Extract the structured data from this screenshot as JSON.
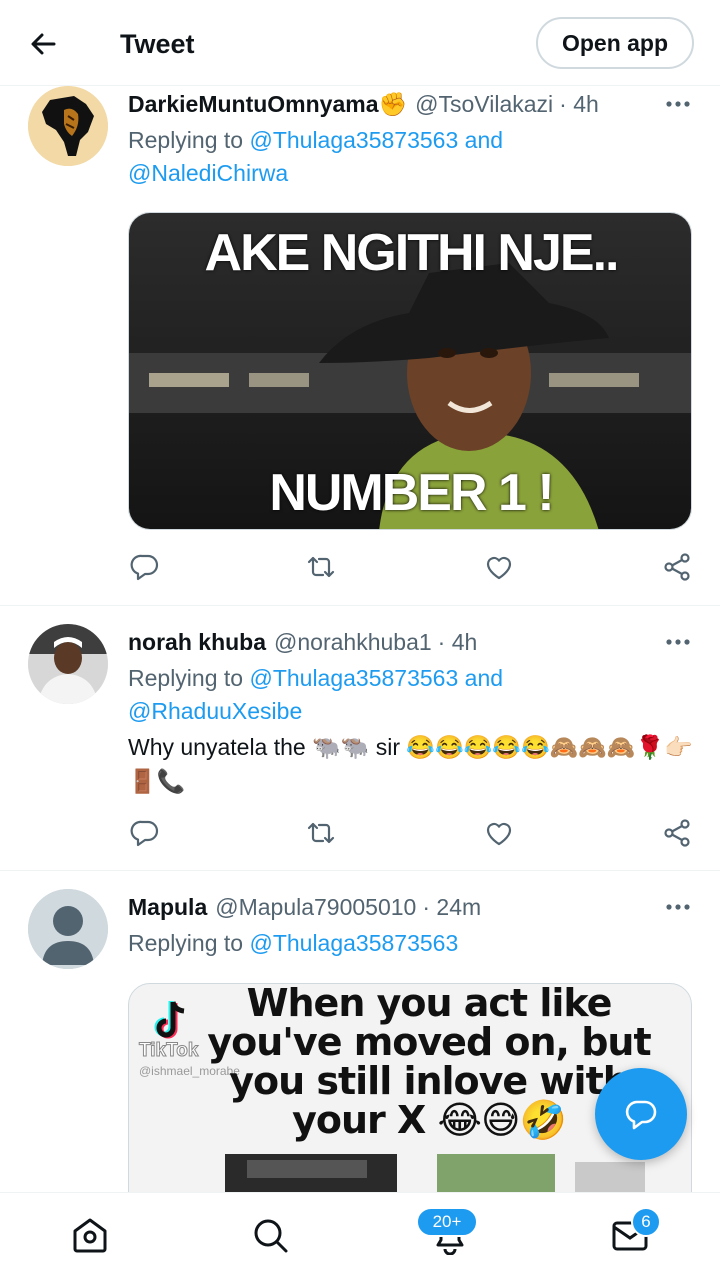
{
  "header": {
    "title": "Tweet",
    "open_app_label": "Open app"
  },
  "tweets": [
    {
      "name": "DarkieMuntuOmnyama",
      "name_emoji": "✊",
      "handle": "@TsoVilakazi",
      "time": "· 4h",
      "replying_prefix": "Replying to",
      "mention_1": "@Thulaga35873563",
      "conjunction": "and",
      "mention_2": "@NalediChirwa",
      "media": {
        "top_text": "AKE NGITHI NJE..",
        "bottom_text": "NUMBER 1 !"
      }
    },
    {
      "name": "norah khuba",
      "handle": "@norahkhuba1",
      "time": "· 4h",
      "replying_prefix": "Replying to",
      "mention_1": "@Thulaga35873563",
      "conjunction": "and",
      "mention_2": "@RhaduuXesibe",
      "text": "Why unyatela the 🐃🐃 sir 😂😂😂😂😂🙈🙈🙈🌹👉🏻🚪📞"
    },
    {
      "name": "Mapula",
      "handle": "@Mapula79005010",
      "time": "· 24m",
      "replying_prefix": "Replying to",
      "mention_1": "@Thulaga35873563",
      "media": {
        "caption_line_1": "When you act like",
        "caption_line_2": "you've moved on, but",
        "caption_line_3": "you still inlove with",
        "caption_line_4": "your X 😂😅🤣",
        "watermark": "TikTok",
        "watermark_user": "@ishmael_morabe"
      }
    }
  ],
  "nav": {
    "notifications_badge": "20+",
    "messages_badge": "6"
  },
  "icons": [
    "back-arrow-icon",
    "more-icon",
    "reply-icon",
    "retweet-icon",
    "like-icon",
    "share-icon",
    "compose-reply-icon",
    "home-icon",
    "search-icon",
    "bell-icon",
    "mail-icon"
  ],
  "colors": {
    "accent": "#1d9bf0",
    "text": "#0f1419",
    "secondary": "#536471"
  }
}
